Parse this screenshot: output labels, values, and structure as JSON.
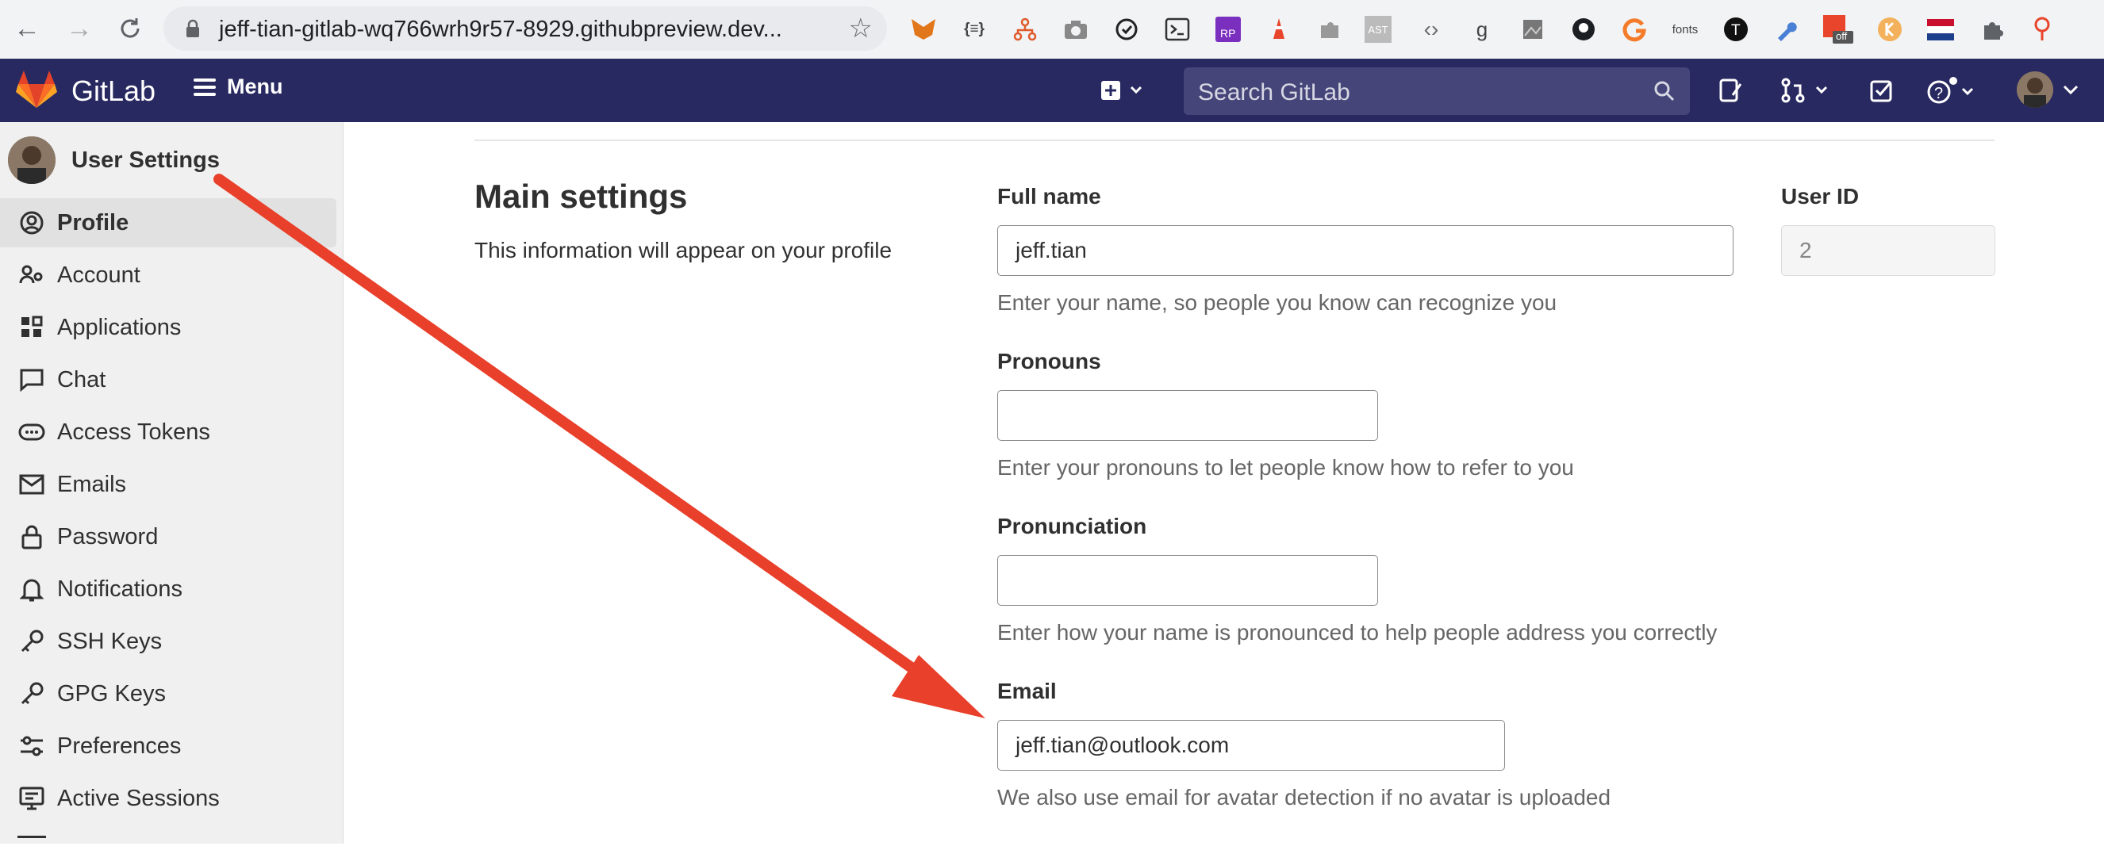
{
  "browser": {
    "url": "jeff-tian-gitlab-wq766wrh9r57-8929.githubpreview.dev...",
    "extensions": [
      "{≡}",
      "AST",
      "fonts",
      "off",
      "g"
    ]
  },
  "header": {
    "brand": "GitLab",
    "menu_label": "Menu",
    "search_placeholder": "Search GitLab"
  },
  "sidebar": {
    "context_title": "User Settings",
    "items": [
      {
        "label": "Profile",
        "icon": "profile-icon"
      },
      {
        "label": "Account",
        "icon": "account-icon"
      },
      {
        "label": "Applications",
        "icon": "applications-icon"
      },
      {
        "label": "Chat",
        "icon": "chat-icon"
      },
      {
        "label": "Access Tokens",
        "icon": "token-icon"
      },
      {
        "label": "Emails",
        "icon": "mail-icon"
      },
      {
        "label": "Password",
        "icon": "lock-icon"
      },
      {
        "label": "Notifications",
        "icon": "bell-icon"
      },
      {
        "label": "SSH Keys",
        "icon": "key-icon"
      },
      {
        "label": "GPG Keys",
        "icon": "key-icon"
      },
      {
        "label": "Preferences",
        "icon": "preferences-icon"
      },
      {
        "label": "Active Sessions",
        "icon": "monitor-icon"
      }
    ]
  },
  "main": {
    "section_title": "Main settings",
    "section_desc": "This information will appear on your profile",
    "fields": {
      "full_name": {
        "label": "Full name",
        "value": "jeff.tian",
        "help": "Enter your name, so people you know can recognize you"
      },
      "user_id": {
        "label": "User ID",
        "value": "2"
      },
      "pronouns": {
        "label": "Pronouns",
        "value": "",
        "help": "Enter your pronouns to let people know how to refer to you"
      },
      "pronunciation": {
        "label": "Pronunciation",
        "value": "",
        "help": "Enter how your name is pronounced to help people address you correctly"
      },
      "email": {
        "label": "Email",
        "value": "jeff.tian@outlook.com",
        "help": "We also use email for avatar detection if no avatar is uploaded"
      }
    }
  },
  "colors": {
    "header_bg": "#292961",
    "annotation_arrow": "#e8402a",
    "sidebar_bg": "#f0f0f0"
  }
}
